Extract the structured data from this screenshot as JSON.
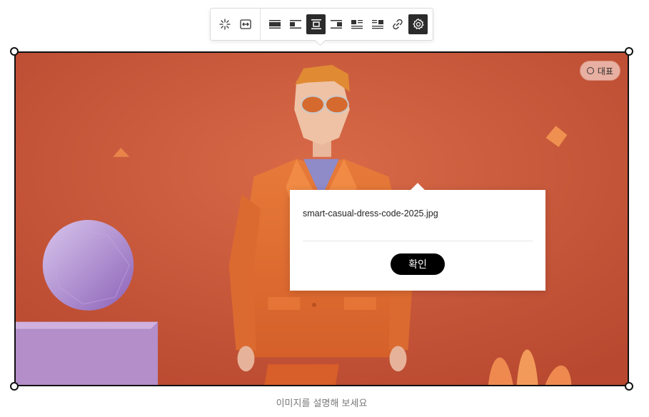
{
  "toolbar": {
    "buttons": [
      {
        "icon": "sparkle-icon",
        "label": "AI"
      },
      {
        "icon": "fit-width-icon",
        "label": "Fit width"
      },
      {
        "icon": "full-width-icon",
        "label": "Full width"
      },
      {
        "icon": "align-left-icon",
        "label": "Align left"
      },
      {
        "icon": "align-center-icon",
        "label": "Align center",
        "active": true
      },
      {
        "icon": "align-right-icon",
        "label": "Align right"
      },
      {
        "icon": "wrap-left-icon",
        "label": "Wrap left"
      },
      {
        "icon": "wrap-right-icon",
        "label": "Wrap right"
      },
      {
        "icon": "link-icon",
        "label": "Link"
      },
      {
        "icon": "settings-icon",
        "label": "Settings",
        "active": true
      }
    ]
  },
  "image": {
    "representative_badge": "대표",
    "accent_background": "#c75a3a"
  },
  "popover": {
    "filename_value": "smart-casual-dress-code-2025.jpg",
    "confirm_label": "확인"
  },
  "caption_placeholder": "이미지를 설명해 보세요"
}
